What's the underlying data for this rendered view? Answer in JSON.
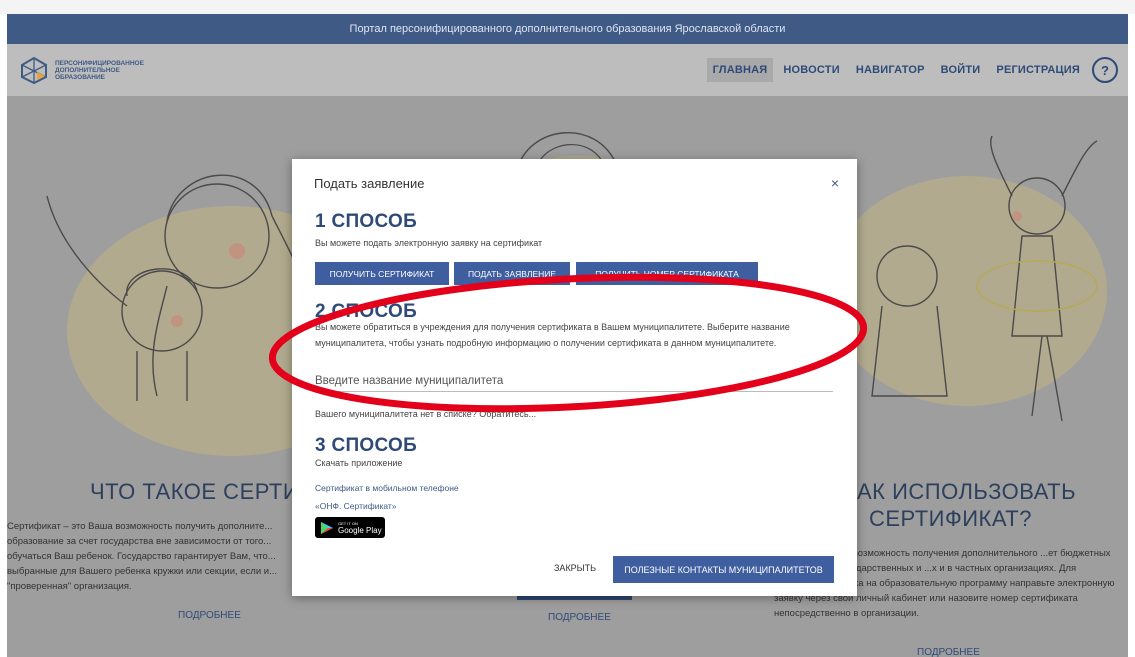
{
  "portal_title": "Портал персонифицированного дополнительного образования Ярославской области",
  "logo": {
    "line1": "ПЕРСОНИФИЦИРОВАННОЕ",
    "line2": "ДОПОЛНИТЕЛЬНОЕ",
    "line3": "ОБРАЗОВАНИЕ"
  },
  "nav": {
    "items": [
      "ГЛАВНАЯ",
      "НОВОСТИ",
      "НАВИГАТОР",
      "ВОЙТИ",
      "РЕГИСТРАЦИЯ"
    ],
    "help": "?"
  },
  "left_card": {
    "title": "ЧТО ТАКОЕ СЕРТИФИ",
    "text": "Сертификат – это Ваша возможность получить дополните... образование за счет государства вне зависимости от того... обучаться Ваш ребенок. Государство гарантирует Вам, что... выбранные для Вашего ребенка кружки или секции, если и... \"проверенная\" организация.",
    "link": "ПОДРОБНЕЕ"
  },
  "mid_card": {
    "link": "ПОДРОБНЕЕ"
  },
  "right_card": {
    "title_line1": "АК ИСПОЛЬЗОВАТЬ",
    "title_line2": "СЕРТИФИКАТ?",
    "text": "...ставляет детям возможность получения дополнительного ...ет бюджетных средств, как в государственных и ...х и в частных организациях. Для зачисления ребенка на образовательную программу направьте электронную заявку через свой личный кабинет или назовите номер сертификата непосредственно в организации.",
    "link": "ПОДРОБНЕЕ"
  },
  "modal": {
    "title": "Подать заявление",
    "close": "×",
    "way1": {
      "heading": "1 СПОСОБ",
      "text": "Вы можете подать электронную заявку на сертификат",
      "buttons": [
        "ПОЛУЧИТЬ СЕРТИФИКАТ",
        "ПОДАТЬ ЗАЯВЛЕНИЕ",
        "ПОЛУЧИТЬ НОМЕР СЕРТИФИКАТА"
      ]
    },
    "way2": {
      "heading": "2 СПОСОБ",
      "text": "Вы можете обратиться в учреждения для получения сертификата в Вашем муниципалитете. Выберите название муниципалитета, чтобы узнать подробную информацию о получении сертификата в данном муниципалитете.",
      "input_placeholder": "Введите название муниципалитета",
      "note": "Вашего муниципалитета нет в списке? Обратитесь..."
    },
    "way3": {
      "heading": "3 СПОСОБ",
      "text": "Скачать приложение",
      "link1": "Сертификат в мобильном телефоне",
      "link2": "«ОНФ. Сертификат»",
      "gplay_small": "GET IT ON",
      "gplay_big": "Google Play"
    },
    "close_label": "ЗАКРЫТЬ",
    "contacts_label": "ПОЛЕЗНЫЕ КОНТАКТЫ МУНИЦИПАЛИТЕТОВ"
  },
  "colors": {
    "brand": "#3f5a85",
    "button": "#3f5ea0",
    "annotation": "#e3001b"
  }
}
